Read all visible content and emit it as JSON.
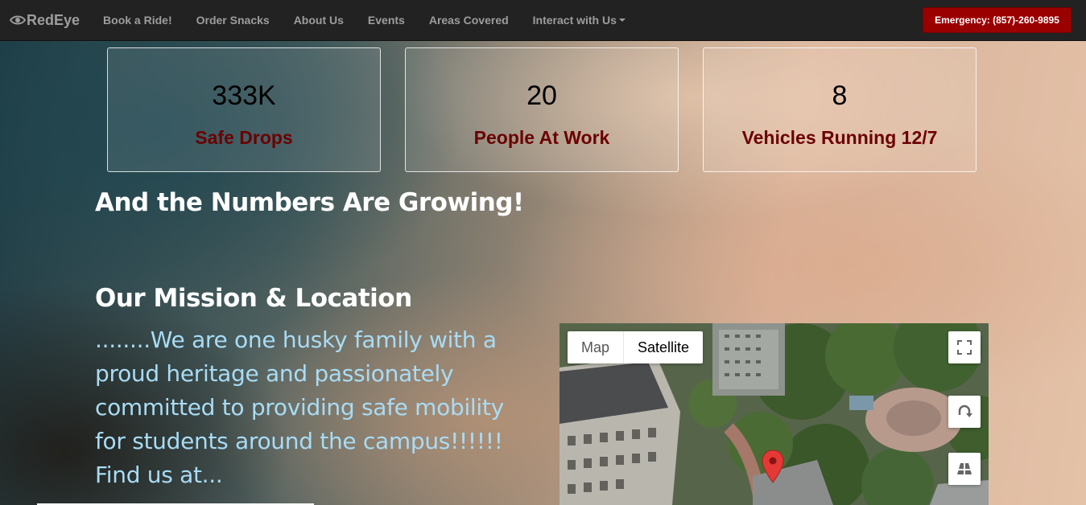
{
  "nav": {
    "brand": "RedEye",
    "items": [
      {
        "label": "Book a Ride!"
      },
      {
        "label": "Order Snacks"
      },
      {
        "label": "About Us"
      },
      {
        "label": "Events"
      },
      {
        "label": "Areas Covered"
      },
      {
        "label": "Interact with Us"
      }
    ],
    "emergency": "Emergency: (857)-260-9895"
  },
  "stats": [
    {
      "number": "333K",
      "label": "Safe Drops"
    },
    {
      "number": "20",
      "label": "People At Work"
    },
    {
      "number": "8",
      "label": "Vehicles Running 12/7"
    }
  ],
  "growing_heading": "And the Numbers Are Growing!",
  "mission": {
    "heading": "Our Mission & Location",
    "line1": "........We are one husky family with a",
    "line2": "proud heritage and passionately",
    "line3": "committed to providing safe mobility",
    "line4": "for students around the campus!!!!!!",
    "line5": "Find us at..."
  },
  "map": {
    "type_map": "Map",
    "type_satellite": "Satellite",
    "selected_type": "Satellite"
  },
  "colors": {
    "navbar": "#222222",
    "emergency": "#9b0000",
    "stat_label": "#6b0000",
    "mission_text": "#a8dcf5"
  }
}
